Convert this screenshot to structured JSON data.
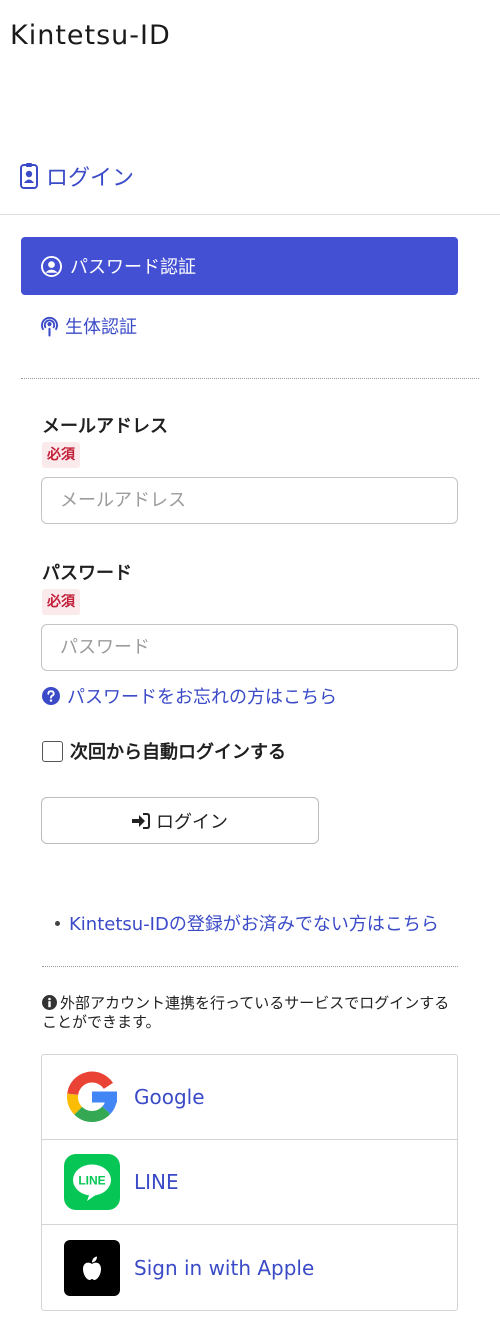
{
  "brand": {
    "logo_text": "Kintetsu-ID"
  },
  "page": {
    "title": "ログイン"
  },
  "auth_tabs": {
    "password": "パスワード認証",
    "biometric": "生体認証"
  },
  "form": {
    "email": {
      "label": "メールアドレス",
      "required_badge": "必須",
      "placeholder": "メールアドレス",
      "value": ""
    },
    "password": {
      "label": "パスワード",
      "required_badge": "必須",
      "placeholder": "パスワード",
      "value": ""
    },
    "forgot_link": "パスワードをお忘れの方はこちら",
    "auto_login_label": "次回から自動ログインする",
    "auto_login_checked": false,
    "login_button": "ログイン"
  },
  "register_link": "Kintetsu-IDの登録がお済みでない方はこちら",
  "external": {
    "info": "外部アカウント連携を行っているサービスでログインすることができます。",
    "providers": [
      {
        "name": "Google",
        "icon": "google-logo-icon"
      },
      {
        "name": "LINE",
        "icon": "line-logo-icon",
        "icon_text": "LINE"
      },
      {
        "name": "Sign in with Apple",
        "icon": "apple-logo-icon"
      }
    ]
  },
  "colors": {
    "primary": "#4350d3",
    "link": "#3b4bc8",
    "required_bg": "#fbeaec",
    "required_text": "#c21f38",
    "line_green": "#06c755"
  }
}
